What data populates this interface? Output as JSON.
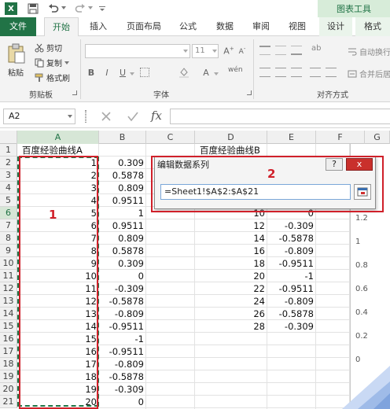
{
  "title_bar": {
    "context_tab_group": "图表工具"
  },
  "tabs": [
    {
      "label": "文件"
    },
    {
      "label": "开始"
    },
    {
      "label": "插入"
    },
    {
      "label": "页面布局"
    },
    {
      "label": "公式"
    },
    {
      "label": "数据"
    },
    {
      "label": "审阅"
    },
    {
      "label": "视图"
    },
    {
      "label": "设计"
    },
    {
      "label": "格式"
    }
  ],
  "ribbon": {
    "paste_label": "粘贴",
    "cut_label": "剪切",
    "copy_label": "复制",
    "format_painter_label": "格式刷",
    "clipboard_group": "剪贴板",
    "font_group": "字体",
    "font_size": "11",
    "bold": "B",
    "italic": "I",
    "underline": "U",
    "font_color": "A",
    "align_group": "对齐方式",
    "wrap_text": "自动换行",
    "merge_center": "合并后居中"
  },
  "formula_bar": {
    "name_box": "A2",
    "fx": "fx"
  },
  "columns": [
    "A",
    "B",
    "C",
    "D",
    "E",
    "F",
    "G"
  ],
  "rows": {
    "numbers": [
      "1",
      "2",
      "3",
      "4",
      "5",
      "6",
      "7",
      "8",
      "9",
      "10",
      "11",
      "12",
      "13",
      "14",
      "15",
      "16",
      "17",
      "18",
      "19",
      "20",
      "21"
    ],
    "selected_row": "6",
    "header_a": "百度经验曲线A",
    "header_d": "百度经验曲线B",
    "col_a": [
      "1",
      "2",
      "3",
      "4",
      "5",
      "6",
      "7",
      "8",
      "9",
      "10",
      "11",
      "12",
      "13",
      "14",
      "15",
      "16",
      "17",
      "18",
      "19",
      "20"
    ],
    "col_b": [
      "0.309",
      "0.5878",
      "0.809",
      "0.9511",
      "1",
      "0.9511",
      "0.809",
      "0.5878",
      "0.309",
      "0",
      "-0.309",
      "-0.5878",
      "-0.809",
      "-0.9511",
      "-1",
      "-0.9511",
      "-0.809",
      "-0.5878",
      "-0.309",
      "0"
    ],
    "col_d": [
      "10",
      "12",
      "14",
      "16",
      "18",
      "20",
      "22",
      "24",
      "26",
      "28"
    ],
    "col_e": [
      "0",
      "-0.309",
      "-0.5878",
      "-0.809",
      "-0.9511",
      "-1",
      "-0.9511",
      "-0.809",
      "-0.5878",
      "-0.309"
    ]
  },
  "chart_axis": [
    "1.2",
    "1",
    "0.8",
    "0.6",
    "0.4",
    "0.2",
    "0"
  ],
  "dialog": {
    "title": "编辑数据系列",
    "help": "?",
    "close": "x",
    "series_value": "=Sheet1!$A$2:$A$21"
  },
  "annotations": {
    "one": "1",
    "two": "2"
  },
  "colors": {
    "accent": "#217346",
    "annotation_red": "#d0202a",
    "context_green": "#d7ecd9"
  }
}
